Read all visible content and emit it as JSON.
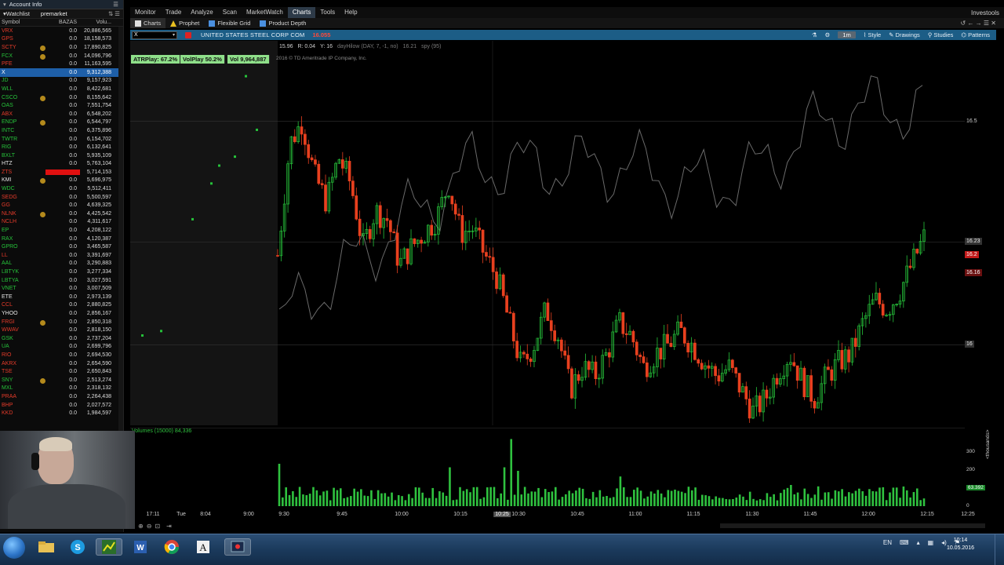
{
  "left_panel": {
    "title": "Account Info",
    "watchlist_label": "Watchlist",
    "watchlist_name": "premarket",
    "columns": [
      "Symbol",
      "BAZAS",
      "Volu..."
    ],
    "rows": [
      {
        "sym": "VRX",
        "chg": "0.0",
        "vol": "20,886,565",
        "color": "red"
      },
      {
        "sym": "GPS",
        "chg": "0.0",
        "vol": "18,158,573",
        "color": "red"
      },
      {
        "sym": "SCTY",
        "chg": "0.0",
        "vol": "17,890,825",
        "color": "red",
        "flag": true
      },
      {
        "sym": "FCX",
        "chg": "0.0",
        "vol": "14,096,796",
        "color": "green",
        "flag": true
      },
      {
        "sym": "PFE",
        "chg": "0.0",
        "vol": "11,163,595",
        "color": "red"
      },
      {
        "sym": "X",
        "chg": "0.0",
        "vol": "9,312,388",
        "color": "white",
        "selected": true
      },
      {
        "sym": "JD",
        "chg": "0.0",
        "vol": "9,157,923",
        "color": "green"
      },
      {
        "sym": "WLL",
        "chg": "0.0",
        "vol": "8,422,681",
        "color": "green"
      },
      {
        "sym": "CSCO",
        "chg": "0.0",
        "vol": "8,155,642",
        "color": "green",
        "flag": true
      },
      {
        "sym": "OAS",
        "chg": "0.0",
        "vol": "7,551,754",
        "color": "green"
      },
      {
        "sym": "ABX",
        "chg": "0.0",
        "vol": "6,548,202",
        "color": "red"
      },
      {
        "sym": "ENDP",
        "chg": "0.0",
        "vol": "6,544,797",
        "color": "green",
        "flag": true
      },
      {
        "sym": "INTC",
        "chg": "0.0",
        "vol": "6,375,896",
        "color": "green"
      },
      {
        "sym": "TWTR",
        "chg": "0.0",
        "vol": "6,154,702",
        "color": "green"
      },
      {
        "sym": "RIG",
        "chg": "0.0",
        "vol": "6,132,641",
        "color": "green"
      },
      {
        "sym": "BXLT",
        "chg": "0.0",
        "vol": "5,935,109",
        "color": "green"
      },
      {
        "sym": "HTZ",
        "chg": "0.0",
        "vol": "5,763,104",
        "color": "white"
      },
      {
        "sym": "ZTS",
        "chg": "0.0",
        "vol": "5,714,153",
        "color": "red",
        "redbg": true
      },
      {
        "sym": "KMI",
        "chg": "0.0",
        "vol": "5,696,975",
        "color": "white",
        "flag": true
      },
      {
        "sym": "WDC",
        "chg": "0.0",
        "vol": "5,512,411",
        "color": "green"
      },
      {
        "sym": "SEDG",
        "chg": "0.0",
        "vol": "5,500,597",
        "color": "red"
      },
      {
        "sym": "GG",
        "chg": "0.0",
        "vol": "4,639,325",
        "color": "red"
      },
      {
        "sym": "NLNK",
        "chg": "0.0",
        "vol": "4,425,542",
        "color": "red",
        "flag": true
      },
      {
        "sym": "NCLH",
        "chg": "0.0",
        "vol": "4,311,617",
        "color": "red"
      },
      {
        "sym": "EP",
        "chg": "0.0",
        "vol": "4,208,122",
        "color": "green"
      },
      {
        "sym": "RAX",
        "chg": "0.0",
        "vol": "4,120,387",
        "color": "green"
      },
      {
        "sym": "GPRO",
        "chg": "0.0",
        "vol": "3,465,587",
        "color": "green"
      },
      {
        "sym": "LL",
        "chg": "0.0",
        "vol": "3,391,697",
        "color": "red"
      },
      {
        "sym": "AAL",
        "chg": "0.0",
        "vol": "3,290,883",
        "color": "green"
      },
      {
        "sym": "LBTYK",
        "chg": "0.0",
        "vol": "3,277,334",
        "color": "green"
      },
      {
        "sym": "LBTYA",
        "chg": "0.0",
        "vol": "3,027,591",
        "color": "green"
      },
      {
        "sym": "VNET",
        "chg": "0.0",
        "vol": "3,007,509",
        "color": "green"
      },
      {
        "sym": "ETE",
        "chg": "0.0",
        "vol": "2,973,139",
        "color": "white"
      },
      {
        "sym": "CCL",
        "chg": "0.0",
        "vol": "2,880,825",
        "color": "red"
      },
      {
        "sym": "YHOO",
        "chg": "0.0",
        "vol": "2,856,167",
        "color": "white"
      },
      {
        "sym": "FRGI",
        "chg": "0.0",
        "vol": "2,850,318",
        "color": "red",
        "flag": true
      },
      {
        "sym": "WWAV",
        "chg": "0.0",
        "vol": "2,818,150",
        "color": "red"
      },
      {
        "sym": "GSK",
        "chg": "0.0",
        "vol": "2,737,204",
        "color": "green"
      },
      {
        "sym": "UA",
        "chg": "0.0",
        "vol": "2,699,796",
        "color": "green"
      },
      {
        "sym": "RIO",
        "chg": "0.0",
        "vol": "2,694,530",
        "color": "red"
      },
      {
        "sym": "AKRX",
        "chg": "0.0",
        "vol": "2,654,590",
        "color": "red"
      },
      {
        "sym": "TSE",
        "chg": "0.0",
        "vol": "2,650,843",
        "color": "red"
      },
      {
        "sym": "SNY",
        "chg": "0.0",
        "vol": "2,513,274",
        "color": "green",
        "flag": true
      },
      {
        "sym": "MXL",
        "chg": "0.0",
        "vol": "2,318,132",
        "color": "green"
      },
      {
        "sym": "PRAA",
        "chg": "0.0",
        "vol": "2,264,438",
        "color": "red"
      },
      {
        "sym": "BHP",
        "chg": "0.0",
        "vol": "2,027,572",
        "color": "red"
      },
      {
        "sym": "KKD",
        "chg": "0.0",
        "vol": "1,984,597",
        "color": "red"
      }
    ]
  },
  "top_menu": {
    "items": [
      "Monitor",
      "Trade",
      "Analyze",
      "Scan",
      "MarketWatch",
      "Charts",
      "Tools",
      "Help"
    ],
    "active": "Charts",
    "brand": "Investools"
  },
  "sub_tabs": [
    {
      "label": "Charts",
      "icon": "chart-icon",
      "color": "#e0e0e0"
    },
    {
      "label": "Prophet",
      "icon": "warning-icon",
      "color": "#e8c020"
    },
    {
      "label": "Flexible Grid",
      "icon": "grid-icon",
      "color": "#4a90e0"
    },
    {
      "label": "Product Depth",
      "icon": "depth-icon",
      "color": "#4a90e0"
    }
  ],
  "chart_toolbar": {
    "symbol": "X",
    "company": "UNITED STATES STEEL CORP COM",
    "last": "16.055",
    "timeframe": "1m",
    "style": "Style",
    "drawings": "Drawings",
    "studies": "Studies",
    "patterns": "Patterns"
  },
  "info_bar": {
    "symbol": "X 1 d 1m",
    "fields": [
      "D: 5/10/16 10:25 AM",
      "O: 16",
      "H: 16",
      "L: 15.96",
      "C: 15.96",
      "R: 0.04",
      "Y: 16"
    ],
    "extra": [
      "dayHilow (DAY, 7, -1, no)",
      "16.21",
      "spy (95)"
    ]
  },
  "studies": {
    "atr": "ATRPlay: 67.2%",
    "volplay": "VolPlay 50.2%",
    "vol": "Vol 9,964,887"
  },
  "copyright": "2016 © TD Ameritrade IP Company, Inc.",
  "price_axis": {
    "labels": [
      {
        "text": "16.5",
        "style": "plain"
      },
      {
        "text": "16.23",
        "style": "box"
      },
      {
        "text": "16.2",
        "style": "redbox"
      },
      {
        "text": "16.16",
        "style": "redbox2"
      },
      {
        "text": "16",
        "style": "box"
      }
    ]
  },
  "volume": {
    "label": "Volumes (15000)",
    "value": "84,336",
    "axis": [
      "300",
      "200",
      "100",
      "0"
    ],
    "current": "63.392",
    "unit": "<thousands>"
  },
  "time_axis": {
    "labels": [
      "17:11",
      "Tue",
      "8:04",
      "9:00",
      "9:30",
      "9:45",
      "10:00",
      "10:15",
      "10:25",
      "10:30",
      "10:45",
      "11:00",
      "11:15",
      "11:30",
      "11:45",
      "12:00",
      "12:15",
      "12:25"
    ],
    "highlight": "10:25"
  },
  "taskbar": {
    "lang": "EN",
    "time": "10:14",
    "date": "10.05.2016"
  },
  "chart_data": {
    "type": "candlestick",
    "title": "UNITED STATES STEEL CORP COM",
    "timeframe": "1m",
    "ylim": [
      15.82,
      16.68
    ],
    "y_ticks": [
      16,
      16.5
    ],
    "x_ticks": [
      "9:30",
      "9:45",
      "10:00",
      "10:15",
      "10:30",
      "10:45",
      "11:00",
      "11:15",
      "11:30",
      "11:45",
      "12:00",
      "12:15"
    ],
    "close_path": [
      16.2,
      16.45,
      16.5,
      16.38,
      16.32,
      16.42,
      16.36,
      16.22,
      16.3,
      16.28,
      16.18,
      16.22,
      16.25,
      16.28,
      16.36,
      16.25,
      16.26,
      16.2,
      16.15,
      16.05,
      15.95,
      16.0,
      16.08,
      16.02,
      15.9,
      15.95,
      15.93,
      15.98,
      16.05,
      16.02,
      15.95,
      15.98,
      16.0,
      16.03,
      16.0,
      15.96,
      15.93,
      15.95,
      15.9,
      15.85,
      15.88,
      15.94,
      15.98,
      15.92,
      15.88,
      15.93,
      15.96,
      15.98,
      16.05,
      16.1,
      16.08,
      16.12,
      16.18,
      16.24
    ],
    "comparison_series": "spy"
  }
}
